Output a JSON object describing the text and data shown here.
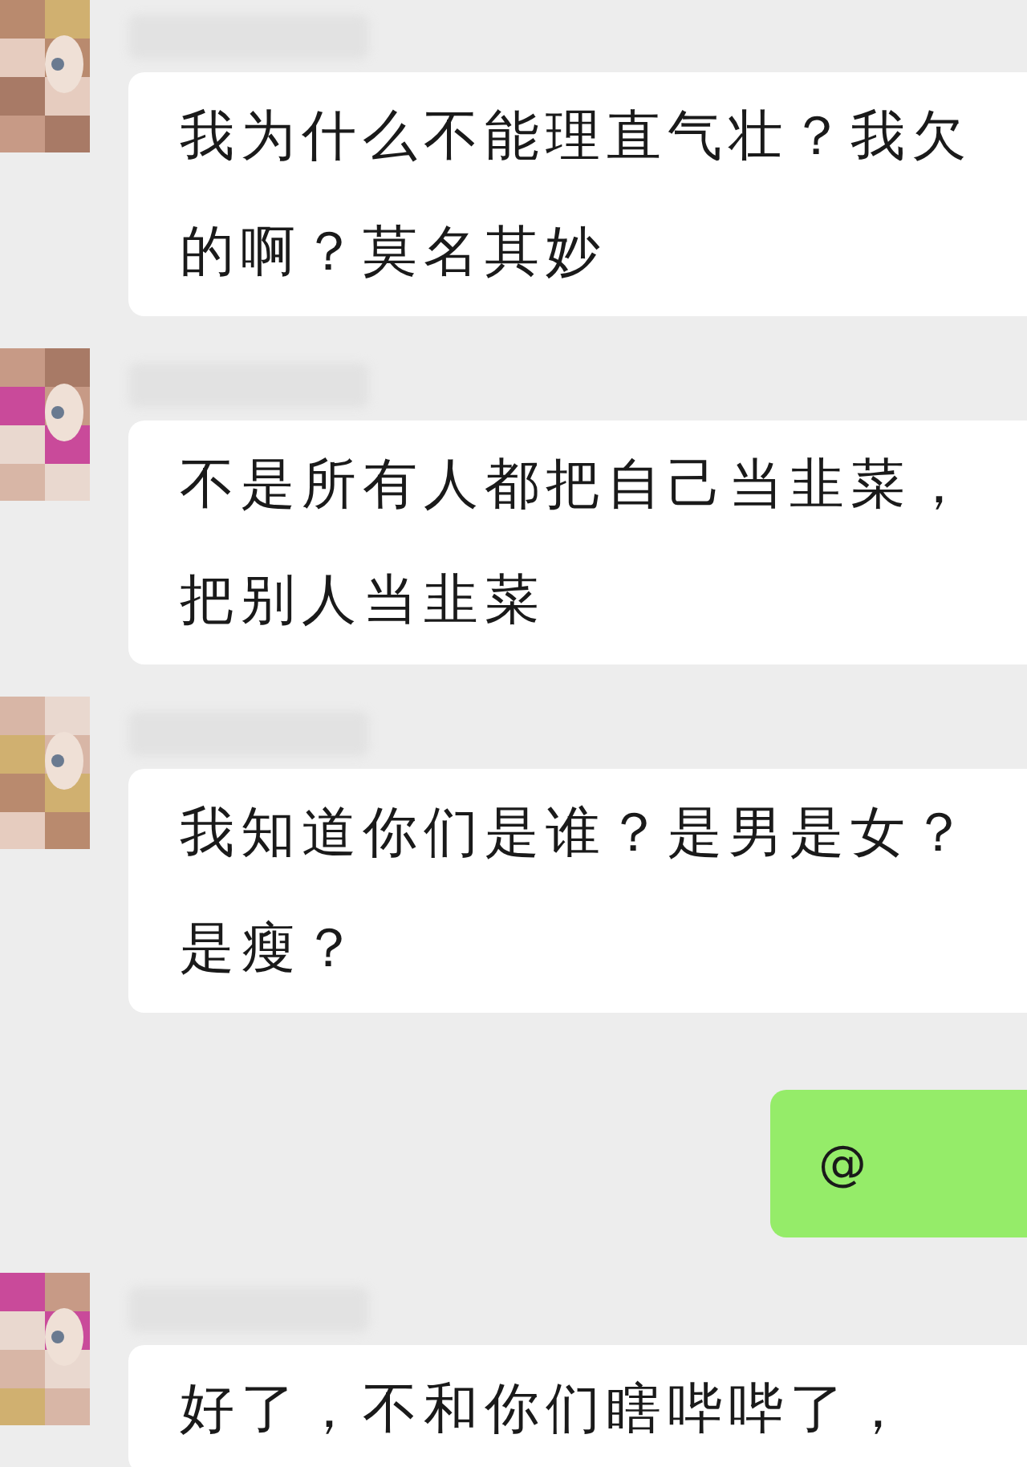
{
  "messages": [
    {
      "kind": "incoming",
      "lines": [
        "我为什么不能理直气壮？我欠",
        "的啊？莫名其妙"
      ]
    },
    {
      "kind": "incoming",
      "lines": [
        "不是所有人都把自己当韭菜，",
        "把别人当韭菜"
      ]
    },
    {
      "kind": "incoming",
      "lines": [
        "我知道你们是谁？是男是女？",
        "是瘦？"
      ]
    },
    {
      "kind": "outgoing",
      "lines": [
        "@"
      ]
    },
    {
      "kind": "incoming",
      "lines": [
        "好了，不和你们瞎哔哔了，"
      ]
    }
  ]
}
